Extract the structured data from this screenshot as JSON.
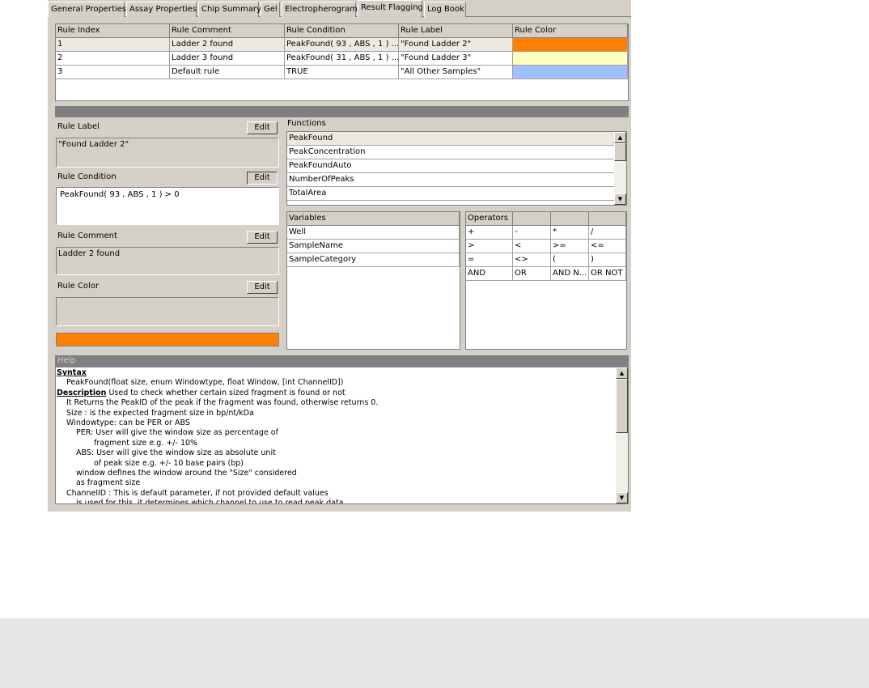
{
  "tabs": [
    "General Properties",
    "Assay Properties",
    "Chip Summary",
    "Gel",
    "Electropherogram",
    "Result Flagging",
    "Log Book"
  ],
  "active_tab": "Result Flagging",
  "rules_table": {
    "columns": [
      "Rule Index",
      "Rule Comment",
      "Rule Condition",
      "Rule Label",
      "Rule Color"
    ],
    "rows": [
      {
        "index": "1",
        "comment": "Ladder 2 found",
        "condition": "PeakFound( 93 , ABS , 1 ) ...",
        "label": "\"Found Ladder 2\"",
        "color": "#ff8000"
      },
      {
        "index": "2",
        "comment": "Ladder 3 found",
        "condition": "PeakFound( 31 , ABS , 1 ) ...",
        "label": "\"Found Ladder 3\"",
        "color": "#ffffc0"
      },
      {
        "index": "3",
        "comment": "Default rule",
        "condition": "TRUE",
        "label": "\"All Other Samples\"",
        "color": "#a0c0ff"
      }
    ]
  },
  "editor": {
    "rule_label_title": "Rule Label",
    "rule_label_value": "\"Found Ladder 2\"",
    "rule_condition_title": "Rule Condition",
    "rule_condition_value": "PeakFound( 93 , ABS , 1 ) > 0",
    "rule_comment_title": "Rule Comment",
    "rule_comment_value": "Ladder 2 found",
    "rule_color_title": "Rule Color",
    "rule_color_value": "#ff8000",
    "edit_label": "Edit"
  },
  "functions": {
    "title": "Functions",
    "items": [
      "PeakFound",
      "PeakConcentration",
      "PeakFoundAuto",
      "NumberOfPeaks",
      "TotalArea"
    ],
    "selected": "PeakFound"
  },
  "variables": {
    "header": "Variables",
    "items": [
      "Well",
      "SampleName",
      "SampleCategory"
    ]
  },
  "operators": {
    "header": "Operators",
    "rows": [
      [
        "+",
        "-",
        "*",
        "/"
      ],
      [
        ">",
        "<",
        ">=",
        "<="
      ],
      [
        "=",
        "<>",
        "(",
        ")"
      ],
      [
        "AND",
        "OR",
        "AND N...",
        "OR NOT"
      ]
    ]
  },
  "help": {
    "title": "Help",
    "lines": [
      {
        "text": "Syntax",
        "indent": 0,
        "head": true
      },
      {
        "text": "PeakFound(float size, enum Windowtype, float Window, [int ChannelID])",
        "indent": 12
      },
      {
        "text": "Description",
        "indent": 0,
        "head": true,
        "suffix": "   Used to check whether certain sized fragment is found or not"
      },
      {
        "text": "It Returns the PeakID of the peak if the fragment was found, otherwise returns 0.",
        "indent": 12
      },
      {
        "text": "Size      : is the expected fragment size in bp/nt/kDa",
        "indent": 12
      },
      {
        "text": "Windowtype: can be PER or ABS",
        "indent": 12
      },
      {
        "text": "PER:    User will give the window size as percentage of",
        "indent": 24
      },
      {
        "text": "fragment size e.g. +/- 10%",
        "indent": 46
      },
      {
        "text": "ABS:    User will give the window size as absolute unit",
        "indent": 24
      },
      {
        "text": "of peak size e.g. +/- 10 base pairs (bp)",
        "indent": 46
      },
      {
        "text": "window defines the window around the \"Size\" considered",
        "indent": 24
      },
      {
        "text": "as fragment size",
        "indent": 24
      },
      {
        "text": "ChannelID : This is default parameter, if not provided default values",
        "indent": 12
      },
      {
        "text": "is used for this, it determines which channel to use to read peak data",
        "indent": 24
      }
    ]
  },
  "colors": {
    "window_bg": "#d4d0c8",
    "orange": "#ff8000",
    "light_yellow": "#ffffc0",
    "light_blue": "#a0c0ff"
  }
}
